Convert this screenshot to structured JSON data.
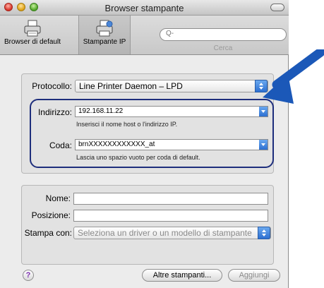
{
  "window": {
    "title": "Browser stampante"
  },
  "toolbar": {
    "default_label": "Browser di default",
    "ip_label": "Stampante IP",
    "search_placeholder": "Q-",
    "search_label": "Cerca"
  },
  "protocol": {
    "label": "Protocollo:",
    "value": "Line Printer Daemon – LPD"
  },
  "address": {
    "label": "Indirizzo:",
    "value": "192.168.11.22",
    "hint": "Inserisci il nome host o l'indirizzo IP."
  },
  "queue": {
    "label": "Coda:",
    "value": "brnXXXXXXXXXXXX_at",
    "hint": "Lascia uno spazio vuoto per coda di default."
  },
  "name": {
    "label": "Nome:",
    "value": ""
  },
  "location": {
    "label": "Posizione:",
    "value": ""
  },
  "print_with": {
    "label": "Stampa con:",
    "value": "Seleziona un driver o un modello di stampante"
  },
  "buttons": {
    "help": "?",
    "more_printers": "Altre stampanti...",
    "add": "Aggiungi"
  },
  "colors": {
    "annotation_arrow": "#1b58b8",
    "highlight": "#1e2e7c",
    "accent": "#2c6fd1"
  }
}
